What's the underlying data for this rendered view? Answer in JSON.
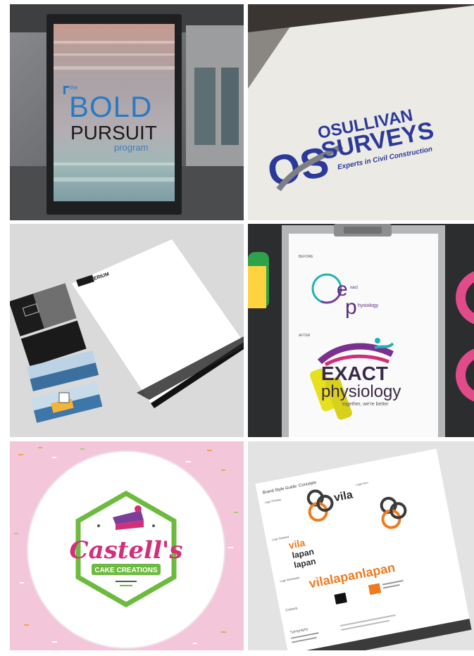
{
  "tiles": {
    "bold": {
      "the": "the",
      "line1": "BOLD",
      "line2": "PURSUIT",
      "line3": "program"
    },
    "osullivan": {
      "monogram": "OS",
      "name": "OSULLIVAN",
      "surveys": "SURVEYS",
      "tagline": "Experts in Civil Construction"
    },
    "stationery": {
      "brand": "IMPERIUM"
    },
    "exact": {
      "before_label": "BEFORE",
      "old_e": "e",
      "old_p": "p",
      "old_xact": "xact",
      "old_hysiology": "hysiology",
      "after_label": "AFTER",
      "word1": "EXACT",
      "word2": "physiology",
      "tagline": "together, we're better"
    },
    "castells": {
      "name": "Castell's",
      "sub": "CAKE CREATIONS"
    },
    "vila": {
      "sheet_title": "Brand Style Guide: Concepts",
      "logo1_label": "Logo Primary",
      "logo2_label": "Logo Icon",
      "logo3_label": "Logo Stacked",
      "logo4_label": "Logo Wordmark",
      "colours_label": "Colours",
      "typography_label": "Typography",
      "vila": "vila",
      "lapan1": "lapan",
      "lapan2": "lapan",
      "wordmark": "vilalapanlapan"
    }
  },
  "colors": {
    "blue": "#2b3a9a",
    "purple": "#5b2d82",
    "teal": "#20b3b1",
    "orange": "#f07b1f",
    "pink": "#d22f7b",
    "green": "#6dbb3e"
  }
}
